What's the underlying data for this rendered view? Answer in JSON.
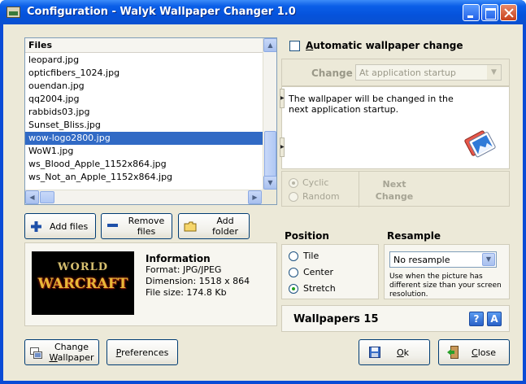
{
  "window": {
    "title": "Configuration - Walyk Wallpaper Changer 1.0"
  },
  "file_list": {
    "header": "Files",
    "items": [
      "leopard.jpg",
      "opticfibers_1024.jpg",
      "ouendan.jpg",
      "qq2004.jpg",
      "rabbids03.jpg",
      "Sunset_Bliss.jpg",
      "wow-logo2800.jpg",
      "WoW1.jpg",
      "ws_Blood_Apple_1152x864.jpg",
      "ws_Not_an_Apple_1152x864.jpg"
    ],
    "selected": "wow-logo2800.jpg"
  },
  "file_buttons": {
    "add_files": "Add files",
    "remove_files_line1": "Remove",
    "remove_files_line2": "files",
    "add_folder_line1": "Add",
    "add_folder_line2": "folder"
  },
  "info": {
    "heading": "Information",
    "format": "Format: JPG/JPEG",
    "dimension": "Dimension: 1518 x 864",
    "file_size": "File size: 174.8 Kb",
    "thumbnail_logo_top": "WORLD",
    "thumbnail_logo_main": "WARCRAFT",
    "thumbnail_logo_sub": "OF"
  },
  "auto_change": {
    "label_accel": "A",
    "label_rest": "utomatic wallpaper change",
    "checked": false
  },
  "change": {
    "label": "Change",
    "selected_value": "At application startup",
    "description": "The wallpaper will be changed in the next application startup."
  },
  "mode": {
    "cyclic": "Cyclic",
    "random": "Random",
    "selected": "Cyclic",
    "next_line1": "Next",
    "next_line2": "Change"
  },
  "position": {
    "title": "Position",
    "options": [
      "Tile",
      "Center",
      "Stretch"
    ],
    "selected": "Stretch"
  },
  "resample": {
    "title": "Resample",
    "selected_value": "No resample",
    "hint": "Use when the picture has different size than your screen resolution."
  },
  "wallpapers": {
    "label": "Wallpapers 15",
    "help_glyph": "?",
    "about_glyph": "A"
  },
  "bottom_buttons": {
    "change_wallpaper_line1": "Change",
    "change_wallpaper_accel": "W",
    "change_wallpaper_rest": "allpaper",
    "preferences_accel": "P",
    "preferences_rest": "references",
    "ok_accel": "O",
    "ok_rest": "k",
    "close_accel": "C",
    "close_rest": "lose"
  },
  "colors": {
    "title_bar": "#0553dc",
    "selection": "#316ac5",
    "dialog_face": "#ece9d8",
    "button_border": "#003c74"
  }
}
